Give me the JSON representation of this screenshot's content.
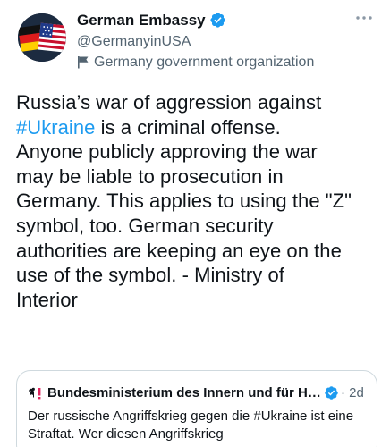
{
  "author": {
    "name": "German Embassy",
    "handle": "@GermanyinUSA",
    "label": "Germany government organization",
    "avatar_icon": "german-us-flags-avatar",
    "verified_icon": "verified-badge-icon"
  },
  "tweet": {
    "text_before": "Russia’s war of aggression against\n",
    "hashtag": "#Ukraine",
    "text_after": " is a criminal offense.\nAnyone publicly approving the war\nmay be liable to prosecution in\nGermany. This applies to using the \"Z\"\nsymbol, too. German security\nauthorities are keeping an eye on the\nuse of the symbol. - Ministry of\nInterior"
  },
  "quote": {
    "prefix_icon": "federal-eagle-icon",
    "author": "Bundesministerium des Innern und für Heimat",
    "time": "· 2d",
    "text": "Der russische Angriffskrieg gegen die #Ukraine ist eine Straftat. Wer diesen Angriffskrieg"
  },
  "colors": {
    "accent": "#1d9bf0",
    "text": "#0f1419",
    "secondary": "#536471",
    "border": "#cfd9de"
  }
}
